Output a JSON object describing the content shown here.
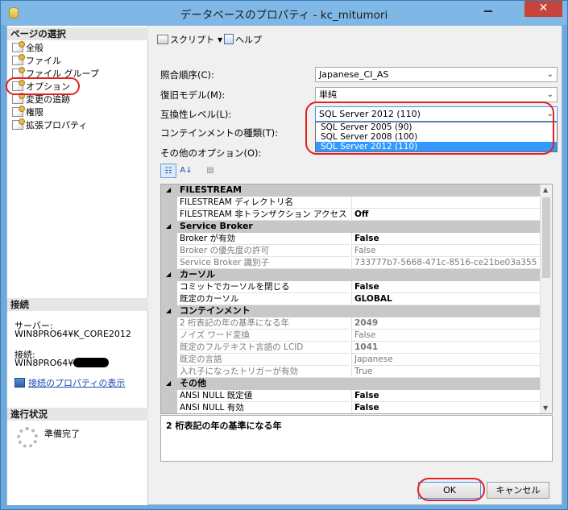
{
  "window": {
    "title": "データベースのプロパティ - kc_mitumori",
    "close_glyph": "✕"
  },
  "left": {
    "select_page_header": "ページの選択",
    "pages": [
      {
        "label": "全般"
      },
      {
        "label": "ファイル"
      },
      {
        "label": "ファイル グループ"
      },
      {
        "label": "オプション"
      },
      {
        "label": "変更の追跡"
      },
      {
        "label": "権限"
      },
      {
        "label": "拡張プロパティ"
      }
    ],
    "connection_header": "接続",
    "server_label": "サーバー:",
    "server_value": "WIN8PRO64¥K_CORE2012",
    "connection_label": "接続:",
    "connection_value": "WIN8PRO64¥",
    "connection_link": "接続のプロパティの表示",
    "progress_header": "進行状況",
    "progress_status": "準備完了"
  },
  "toolbar": {
    "script_label": "スクリプト",
    "help_label": "ヘルプ"
  },
  "form": {
    "collation_label": "照合順序(C):",
    "collation_value": "Japanese_CI_AS",
    "recovery_label": "復旧モデル(M):",
    "recovery_value": "単純",
    "compat_label": "互換性レベル(L):",
    "compat_value": "SQL Server 2012 (110)",
    "compat_options": [
      "SQL Server 2005 (90)",
      "SQL Server 2008 (100)",
      "SQL Server 2012 (110)"
    ],
    "containment_label": "コンテインメントの種類(T):",
    "other_options_label": "その他のオプション(O):"
  },
  "grid": {
    "rows": [
      {
        "type": "cat",
        "name": "FILESTREAM"
      },
      {
        "type": "prop",
        "name": "FILESTREAM ディレクトリ名",
        "value": ""
      },
      {
        "type": "prop",
        "name": "FILESTREAM 非トランザクション アクセス",
        "value": "Off"
      },
      {
        "type": "cat",
        "name": "Service Broker"
      },
      {
        "type": "prop",
        "name": "Broker が有効",
        "value": "False"
      },
      {
        "type": "prop",
        "ro": true,
        "name": "Broker の優先度の許可",
        "value": "False"
      },
      {
        "type": "prop",
        "ro": true,
        "name": "Service Broker 識別子",
        "value": "733777b7-5668-471c-8516-ce21be03a355"
      },
      {
        "type": "cat",
        "name": "カーソル"
      },
      {
        "type": "prop",
        "name": "コミットでカーソルを閉じる",
        "value": "False"
      },
      {
        "type": "prop",
        "name": "既定のカーソル",
        "value": "GLOBAL"
      },
      {
        "type": "cat",
        "name": "コンテインメント"
      },
      {
        "type": "prop",
        "ro": true,
        "bold": true,
        "name": "2 桁表記の年の基準になる年",
        "value": "2049"
      },
      {
        "type": "prop",
        "ro": true,
        "name": "ノイズ ワード変換",
        "value": "False"
      },
      {
        "type": "prop",
        "ro": true,
        "bold": true,
        "name": "既定のフルテキスト言語の LCID",
        "value": "1041"
      },
      {
        "type": "prop",
        "ro": true,
        "name": "既定の言語",
        "value": "Japanese"
      },
      {
        "type": "prop",
        "ro": true,
        "name": "入れ子になったトリガーが有効",
        "value": "True"
      },
      {
        "type": "cat",
        "name": "その他"
      },
      {
        "type": "prop",
        "name": "ANSI NULL 既定値",
        "value": "False"
      },
      {
        "type": "prop",
        "name": "ANSI NULL 有効",
        "value": "False"
      }
    ],
    "description": "2 桁表記の年の基準になる年"
  },
  "buttons": {
    "ok": "OK",
    "cancel": "キャンセル"
  }
}
